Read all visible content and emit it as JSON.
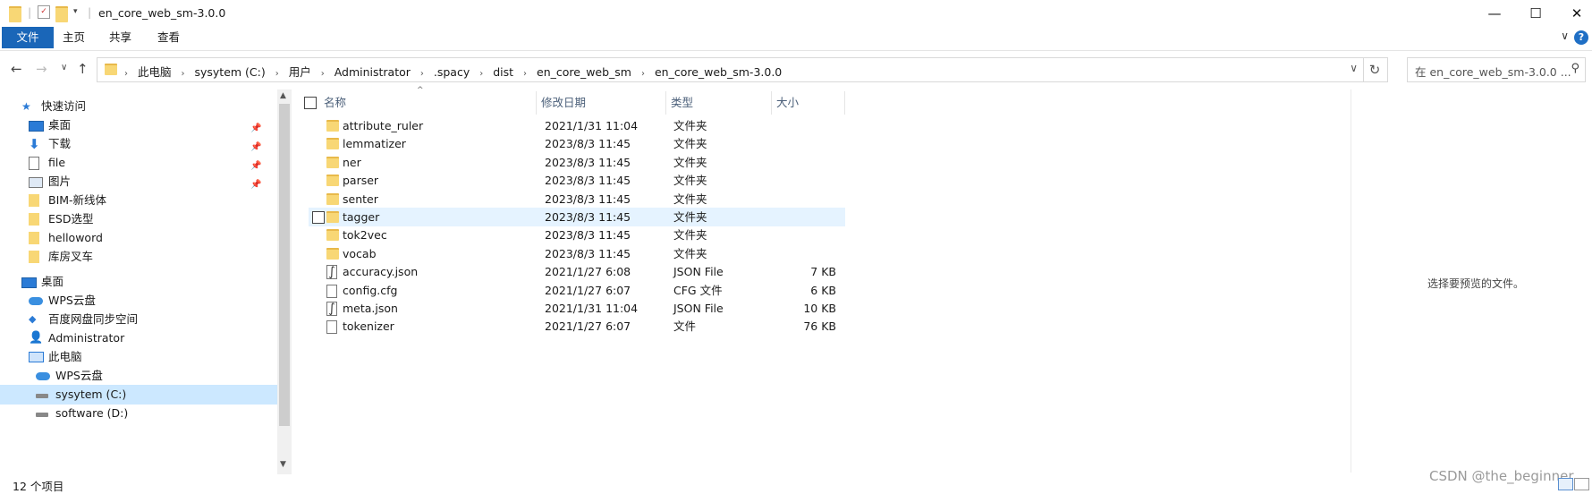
{
  "window": {
    "title": "en_core_web_sm-3.0.0",
    "minimize": "—",
    "maximize": "☐",
    "close": "✕"
  },
  "ribbon": {
    "tabs": [
      "文件",
      "主页",
      "共享",
      "查看"
    ],
    "help": "?",
    "collapse": "∨"
  },
  "nav": {
    "back": "←",
    "forward": "→",
    "recent": "∨",
    "up": "↑",
    "breadcrumb": [
      "此电脑",
      "sysytem (C:)",
      "用户",
      "Administrator",
      ".spacy",
      "dist",
      "en_core_web_sm",
      "en_core_web_sm-3.0.0"
    ],
    "refresh": "↻",
    "search_placeholder": "在 en_core_web_sm-3.0.0 ..."
  },
  "sidebar": {
    "items": [
      {
        "label": "快速访问",
        "icon": "star-icon",
        "pinned": false
      },
      {
        "label": "桌面",
        "icon": "desktop-icon",
        "pinned": true
      },
      {
        "label": "下载",
        "icon": "download-icon",
        "pinned": true
      },
      {
        "label": "file",
        "icon": "document-icon",
        "pinned": true
      },
      {
        "label": "图片",
        "icon": "picture-icon",
        "pinned": true
      },
      {
        "label": "BIM-新线体",
        "icon": "folder-icon",
        "pinned": false
      },
      {
        "label": "ESD选型",
        "icon": "folder-icon",
        "pinned": false
      },
      {
        "label": "helloword",
        "icon": "folder-icon",
        "pinned": false
      },
      {
        "label": "库房叉车",
        "icon": "folder-icon",
        "pinned": false
      },
      {
        "label": "桌面",
        "icon": "desktop-icon",
        "pinned": false
      },
      {
        "label": "WPS云盘",
        "icon": "cloud-icon",
        "pinned": false
      },
      {
        "label": "百度网盘同步空间",
        "icon": "baidu-icon",
        "pinned": false
      },
      {
        "label": "Administrator",
        "icon": "user-icon",
        "pinned": false
      },
      {
        "label": "此电脑",
        "icon": "computer-icon",
        "pinned": false
      },
      {
        "label": "WPS云盘",
        "icon": "cloud-icon",
        "pinned": false
      },
      {
        "label": "sysytem (C:)",
        "icon": "drive-icon",
        "pinned": false
      },
      {
        "label": "software (D:)",
        "icon": "drive-icon",
        "pinned": false
      }
    ]
  },
  "columns": {
    "name": "名称",
    "date": "修改日期",
    "type": "类型",
    "size": "大小"
  },
  "files": [
    {
      "name": "attribute_ruler",
      "date": "2021/1/31 11:04",
      "type": "文件夹",
      "size": "",
      "kind": "folder"
    },
    {
      "name": "lemmatizer",
      "date": "2023/8/3 11:45",
      "type": "文件夹",
      "size": "",
      "kind": "folder"
    },
    {
      "name": "ner",
      "date": "2023/8/3 11:45",
      "type": "文件夹",
      "size": "",
      "kind": "folder"
    },
    {
      "name": "parser",
      "date": "2023/8/3 11:45",
      "type": "文件夹",
      "size": "",
      "kind": "folder"
    },
    {
      "name": "senter",
      "date": "2023/8/3 11:45",
      "type": "文件夹",
      "size": "",
      "kind": "folder"
    },
    {
      "name": "tagger",
      "date": "2023/8/3 11:45",
      "type": "文件夹",
      "size": "",
      "kind": "folder"
    },
    {
      "name": "tok2vec",
      "date": "2023/8/3 11:45",
      "type": "文件夹",
      "size": "",
      "kind": "folder"
    },
    {
      "name": "vocab",
      "date": "2023/8/3 11:45",
      "type": "文件夹",
      "size": "",
      "kind": "folder"
    },
    {
      "name": "accuracy.json",
      "date": "2021/1/27 6:08",
      "type": "JSON File",
      "size": "7 KB",
      "kind": "json"
    },
    {
      "name": "config.cfg",
      "date": "2021/1/27 6:07",
      "type": "CFG 文件",
      "size": "6 KB",
      "kind": "file"
    },
    {
      "name": "meta.json",
      "date": "2021/1/31 11:04",
      "type": "JSON File",
      "size": "10 KB",
      "kind": "json"
    },
    {
      "name": "tokenizer",
      "date": "2021/1/27 6:07",
      "type": "文件",
      "size": "76 KB",
      "kind": "file"
    }
  ],
  "preview": {
    "message": "选择要预览的文件。"
  },
  "status": {
    "count": "12 个项目"
  },
  "watermark": "CSDN @the_beginner",
  "colors": {
    "accent": "#1a66b8",
    "folder": "#f8d775",
    "selected": "#cce8ff",
    "hover": "#e5f3ff"
  }
}
